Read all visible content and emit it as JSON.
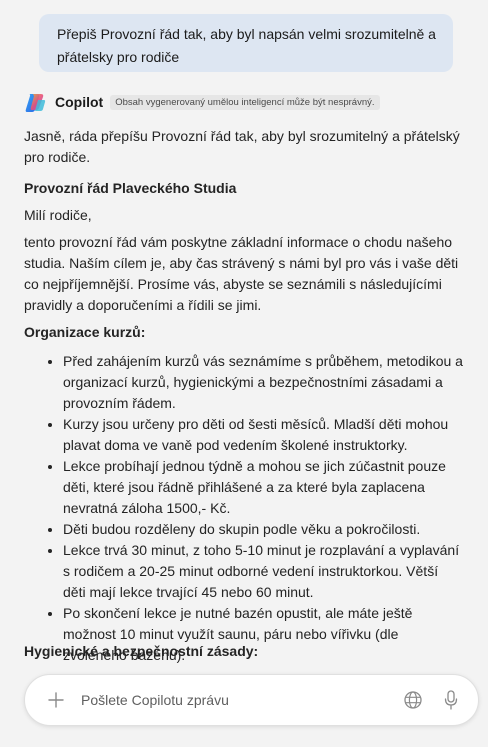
{
  "user_message": "Přepiš Provozní řád tak, aby byl napsán velmi srozumitelně a přátelsky pro rodiče",
  "bot": {
    "name": "Copilot",
    "disclaimer": "Obsah vygenerovaný umělou inteligencí může být nesprávný."
  },
  "answer": {
    "intro": "Jasně, ráda přepíšu Provozní řád tak, aby byl srozumitelný a přátelský pro rodiče.",
    "doc_title": "Provozní řád Plaveckého Studia",
    "greeting": "Milí rodiče,",
    "paragraph": "tento provozní řád vám poskytne základní informace o chodu našeho studia. Naším cílem je, aby čas strávený s námi byl pro vás i vaše děti co nejpříjemnější. Prosíme vás, abyste se seznámili s následujícími pravidly a doporučeními a řídili se jimi.",
    "section1_title": "Organizace kurzů:",
    "section1_items": [
      "Před zahájením kurzů vás seznámíme s průběhem, metodikou a organizací kurzů, hygienickými a bezpečnostními zásadami a provozním řádem.",
      "Kurzy jsou určeny pro děti od šesti měsíců. Mladší děti mohou plavat doma ve vaně pod vedením školené instruktorky.",
      "Lekce probíhají jednou týdně a mohou se jich zúčastnit pouze děti, které jsou řádně přihlášené a za které byla zaplacena nevratná záloha 1500,- Kč.",
      "Děti budou rozděleny do skupin podle věku a pokročilosti.",
      "Lekce trvá 30 minut, z toho 5-10 minut je rozplavání a vyplavání s rodičem a 20-25 minut odborné vedení instruktorkou. Větší děti mají lekce trvající 45 nebo 60 minut.",
      "Po skončení lekce je nutné bazén opustit, ale máte ještě možnost 10 minut využít saunu, páru nebo vířivku (dle zvoleného bazénu)."
    ],
    "section2_title": "Hygienické a bezpečnostní zásady:"
  },
  "composer": {
    "placeholder": "Pošlete Copilotu zprávu"
  },
  "icons": {
    "plus": "plus-icon",
    "globe": "globe-icon",
    "mic": "microphone-icon",
    "logo": "copilot-logo"
  },
  "colors": {
    "background": "#f3f3f3",
    "user_bubble": "#dde6f2"
  }
}
